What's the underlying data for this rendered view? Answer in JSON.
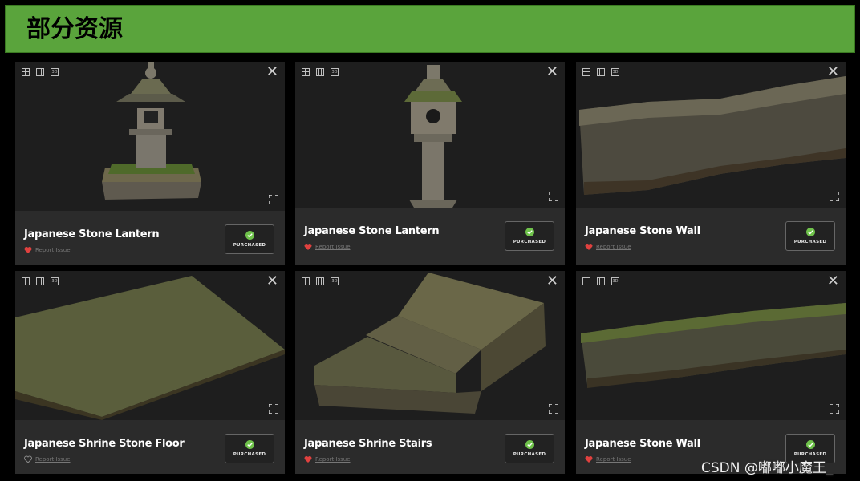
{
  "header": {
    "title": "部分资源"
  },
  "view_icons": [
    "grid-view-icon",
    "columns-view-icon",
    "3d-view-icon"
  ],
  "view_icon_3d_label": "3D",
  "close_glyph": "✕",
  "colors": {
    "header_bg": "#5aa43c",
    "card_info_bg": "#2b2b2b",
    "heart_filled": "#e0413f",
    "check_green": "#6fc24b"
  },
  "cards": [
    {
      "title": "Japanese Stone Lantern",
      "report": "Report Issue",
      "button": "PURCHASED",
      "favorited": true
    },
    {
      "title": "Japanese Stone Lantern",
      "report": "Report Issue",
      "button": "PURCHASED",
      "favorited": true
    },
    {
      "title": "Japanese Stone Wall",
      "report": "Report Issue",
      "button": "PURCHASED",
      "favorited": true
    },
    {
      "title": "Japanese Shrine Stone Floor",
      "report": "Report Issue",
      "button": "PURCHASED",
      "favorited": false
    },
    {
      "title": "Japanese Shrine Stairs",
      "report": "Report Issue",
      "button": "PURCHASED",
      "favorited": true
    },
    {
      "title": "Japanese Stone Wall",
      "report": "Report Issue",
      "button": "PURCHASED",
      "favorited": true
    }
  ],
  "watermark": "CSDN @嘟嘟小魔王_"
}
